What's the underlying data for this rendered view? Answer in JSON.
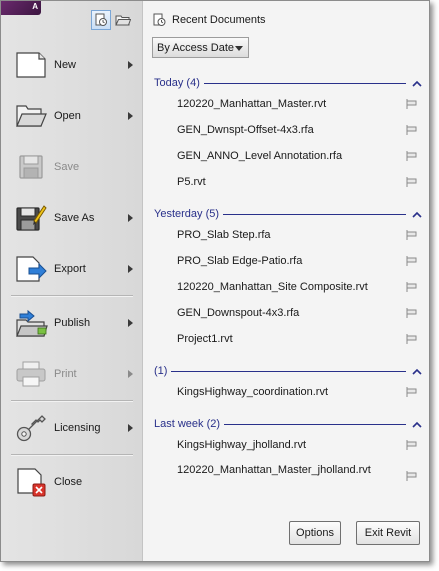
{
  "toolbar": {
    "logo_letter": "A"
  },
  "commands": [
    {
      "id": "new",
      "label": "New",
      "has_submenu": true,
      "enabled": true
    },
    {
      "id": "open",
      "label": "Open",
      "has_submenu": true,
      "enabled": true
    },
    {
      "id": "save",
      "label": "Save",
      "has_submenu": false,
      "enabled": false
    },
    {
      "id": "save-as",
      "label": "Save As",
      "has_submenu": true,
      "enabled": true
    },
    {
      "id": "export",
      "label": "Export",
      "has_submenu": true,
      "enabled": true
    },
    {
      "id": "publish",
      "label": "Publish",
      "has_submenu": true,
      "enabled": true
    },
    {
      "id": "print",
      "label": "Print",
      "has_submenu": true,
      "enabled": false
    },
    {
      "id": "licensing",
      "label": "Licensing",
      "has_submenu": true,
      "enabled": true
    },
    {
      "id": "close",
      "label": "Close",
      "has_submenu": false,
      "enabled": true
    }
  ],
  "recent": {
    "title": "Recent Documents",
    "sort_label": "By Access Date",
    "groups": [
      {
        "title": "Today (4)",
        "items": [
          "120220_Manhattan_Master.rvt",
          "GEN_Dwnspt-Offset-4x3.rfa",
          "GEN_ANNO_Level Annotation.rfa",
          "P5.rvt"
        ]
      },
      {
        "title": "Yesterday (5)",
        "items": [
          "PRO_Slab Step.rfa",
          "PRO_Slab Edge-Patio.rfa",
          "120220_Manhattan_Site Composite.rvt",
          "GEN_Downspout-4x3.rfa",
          "Project1.rvt"
        ]
      },
      {
        "title": "(1)",
        "items": [
          "KingsHighway_coordination.rvt"
        ]
      },
      {
        "title": "Last week (2)",
        "items": [
          "KingsHighway_jholland.rvt",
          "120220_Manhattan_Master_jholland.rvt"
        ]
      }
    ]
  },
  "buttons": {
    "options": "Options",
    "exit": "Exit Revit"
  },
  "colors": {
    "group_header": "#29308a",
    "disabled_text": "#8a8a8a",
    "close_badge": "#d9342b"
  }
}
